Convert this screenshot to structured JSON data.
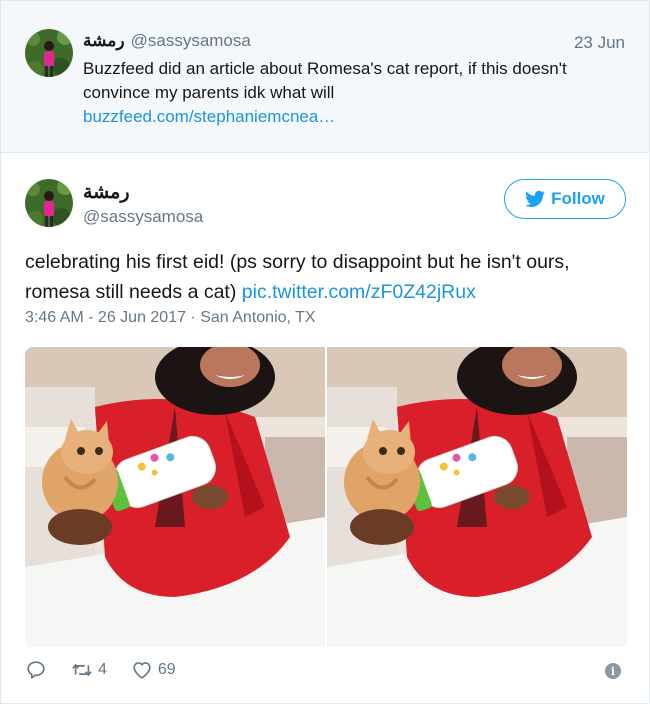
{
  "parent_tweet": {
    "author_name": "رمشة",
    "handle": "@sassysamosa",
    "date": "23 Jun",
    "text": "Buzzfeed did an article about Romesa's cat report, if this doesn't convince my parents idk what will",
    "link": "buzzfeed.com/stephaniemcnea…"
  },
  "tweet": {
    "author_name": "رمشة",
    "handle": "@sassysamosa",
    "follow_label": "Follow",
    "text": "celebrating his first eid! (ps sorry to disappoint but he isn't ours, romesa still needs a cat)",
    "link": "pic.twitter.com/zF0Z42jRux",
    "timestamp": "3:46 AM - 26 Jun 2017 · San Antonio, TX",
    "retweets": "4",
    "likes": "69"
  },
  "icons": {
    "follow": "twitter-bird-icon",
    "reply": "reply-icon",
    "retweet": "retweet-icon",
    "like": "heart-icon",
    "info": "info-icon"
  },
  "colors": {
    "accent": "#1da1f2",
    "link": "#1b95e0",
    "muted": "#657786",
    "parent_bg": "#f5f8fa"
  }
}
